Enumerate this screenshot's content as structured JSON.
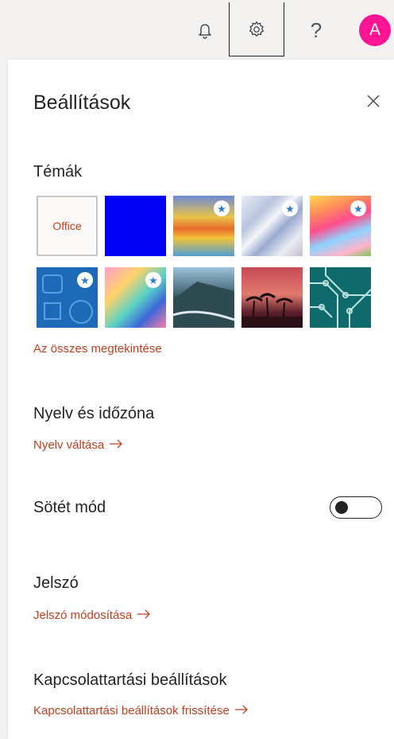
{
  "topbar": {
    "icons": [
      "bell-icon",
      "gear-icon",
      "help-icon"
    ],
    "help_glyph": "?",
    "avatar_initial": "A",
    "avatar_color": "#ff1493"
  },
  "panel": {
    "title": "Beállítások",
    "close_icon": "close-icon",
    "themes": {
      "title": "Témák",
      "office_label": "Office",
      "items": [
        {
          "name": "office",
          "premium": false
        },
        {
          "name": "blue",
          "premium": false
        },
        {
          "name": "sunrise-stripes",
          "premium": true
        },
        {
          "name": "silver-waves",
          "premium": true
        },
        {
          "name": "colorful-unicorn",
          "premium": true
        },
        {
          "name": "blue-doodles",
          "premium": true
        },
        {
          "name": "pink-game",
          "premium": true
        },
        {
          "name": "mountain-coast",
          "premium": false
        },
        {
          "name": "palm-sunset",
          "premium": false
        },
        {
          "name": "circuit-board",
          "premium": false
        }
      ],
      "see_all": "Az összes megtekintése"
    },
    "language": {
      "title": "Nyelv és időzóna",
      "link": "Nyelv váltása"
    },
    "dark_mode": {
      "title": "Sötét mód",
      "enabled": false
    },
    "password": {
      "title": "Jelszó",
      "link": "Jelszó módosítása"
    },
    "contact": {
      "title": "Kapcsolattartási beállítások",
      "link": "Kapcsolattartási beállítások frissítése"
    },
    "accent_color": "#c43e1c"
  }
}
